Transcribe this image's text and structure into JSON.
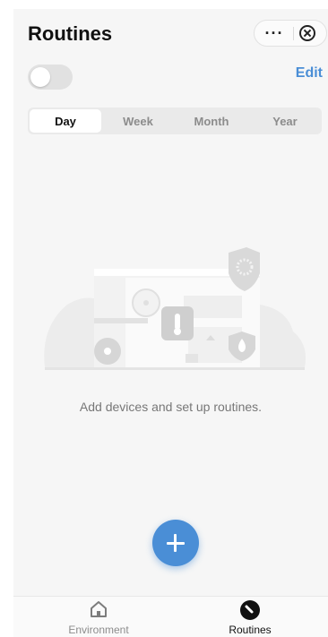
{
  "header": {
    "title": "Routines"
  },
  "capsule": {
    "more_label": "···"
  },
  "toggle": {
    "state": "off"
  },
  "edit_label": "Edit",
  "period_tabs": [
    {
      "label": "Day",
      "active": true
    },
    {
      "label": "Week",
      "active": false
    },
    {
      "label": "Month",
      "active": false
    },
    {
      "label": "Year",
      "active": false
    }
  ],
  "empty_state": {
    "message": "Add devices and set up routines."
  },
  "bottom_nav": [
    {
      "label": "Environment",
      "icon": "home-icon",
      "active": false
    },
    {
      "label": "Routines",
      "icon": "routines-icon",
      "active": true
    }
  ],
  "colors": {
    "accent": "#4a8ed6",
    "background": "#f6f6f6"
  }
}
